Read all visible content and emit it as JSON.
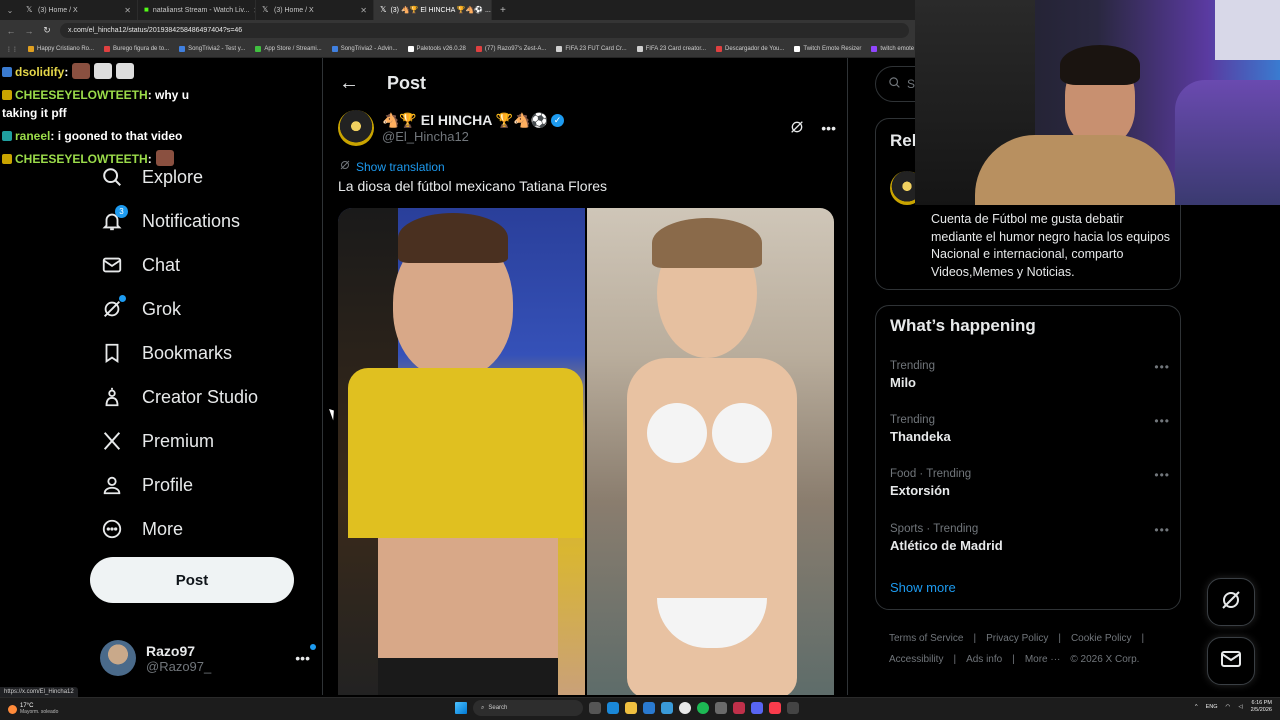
{
  "browser": {
    "tabs": [
      {
        "label": "(3) Home / X",
        "active": false
      },
      {
        "label": "natalianst Stream - Watch Liv...",
        "active": false
      },
      {
        "label": "(3) Home / X",
        "active": false
      },
      {
        "label": "(3) 🐴🏆 El HINCHA 🏆🐴⚽ ...",
        "active": true
      }
    ],
    "url": "x.com/el_hincha12/status/2019384258486497404?s=46",
    "bookmarks": [
      {
        "label": "Happy Cristiano Ro...",
        "color": "#e0a020"
      },
      {
        "label": "Burego figura de to...",
        "color": "#e04040"
      },
      {
        "label": "SongTrivia2 - Test y...",
        "color": "#4080e0"
      },
      {
        "label": "App Store / Streami...",
        "color": "#40c040"
      },
      {
        "label": "SongTrivia2 - Advin...",
        "color": "#4080e0"
      },
      {
        "label": "Paletools v26.0.28",
        "color": "#ffffff"
      },
      {
        "label": "(77) Razo97's Zest-A...",
        "color": "#e04040"
      },
      {
        "label": "FIFA 23 FUT Card Cr...",
        "color": "#d0d0d0"
      },
      {
        "label": "FIFA 23 Card creator...",
        "color": "#d0d0d0"
      },
      {
        "label": "Descargador de You...",
        "color": "#e04040"
      },
      {
        "label": "Twitch Emote Resizer",
        "color": "#ffffff"
      },
      {
        "label": "twitch emote re...",
        "color": "#9146ff"
      }
    ],
    "status_url": "https://x.com/El_Hincha12"
  },
  "chat": [
    {
      "user": "dsolidify",
      "color": "#e6d84a",
      "text": ":"
    },
    {
      "user": "CHEESEYELOWTEETH",
      "color": "#9bdc4a",
      "text": ": why u taking it pff"
    },
    {
      "user": "raneel",
      "color": "#9bdc4a",
      "text": ": i gooned to that video"
    },
    {
      "user": "CHEESEYELOWTEETH",
      "color": "#9bdc4a",
      "text": ":"
    }
  ],
  "sidebar": {
    "items": [
      {
        "label": "Explore",
        "icon": "search-icon"
      },
      {
        "label": "Notifications",
        "icon": "bell-icon",
        "badge": "3"
      },
      {
        "label": "Chat",
        "icon": "mail-icon"
      },
      {
        "label": "Grok",
        "icon": "grok-icon"
      },
      {
        "label": "Bookmarks",
        "icon": "bookmark-icon"
      },
      {
        "label": "Creator Studio",
        "icon": "creator-icon"
      },
      {
        "label": "Premium",
        "icon": "x-logo-icon"
      },
      {
        "label": "Profile",
        "icon": "person-icon"
      },
      {
        "label": "More",
        "icon": "more-circle-icon"
      }
    ],
    "post_button": "Post",
    "account": {
      "name": "Razo97",
      "handle": "@Razo97_"
    }
  },
  "main": {
    "title": "Post",
    "author": {
      "name": "🐴🏆 El HINCHA 🏆🐴⚽",
      "handle": "@El_Hincha12"
    },
    "show_translation": "Show translation",
    "text": "La diosa del fútbol mexicano Tatiana Flores"
  },
  "right": {
    "search_placeholder": "Se",
    "relevant_title": "Rel",
    "bio": "Cuenta de Fútbol me gusta debatir mediante el humor negro hacia los equipos Nacional e internacional, comparto Videos,Memes y Noticias.",
    "happening_title": "What’s happening",
    "trends": [
      {
        "meta": "Trending",
        "name": "Milo"
      },
      {
        "meta": "Trending",
        "name": "Thandeka"
      },
      {
        "meta": "Food · Trending",
        "name": "Extorsión"
      },
      {
        "meta": "Sports · Trending",
        "name": "Atlético de Madrid"
      }
    ],
    "show_more": "Show more",
    "footer": [
      "Terms of Service",
      "|",
      "Privacy Policy",
      "|",
      "Cookie Policy",
      "|",
      "Accessibility",
      "|",
      "Ads info",
      "|",
      "More ···",
      "© 2026 X Corp."
    ]
  },
  "taskbar": {
    "temp": "17°C",
    "weather": "Mayorm. soleado",
    "search": "Search",
    "lang": "ENG",
    "time": "6:16 PM",
    "date": "2/5/2026"
  },
  "colors": {
    "accent": "#1d9bf0",
    "background": "#000000",
    "border": "#2f3336",
    "muted": "#71767b"
  }
}
